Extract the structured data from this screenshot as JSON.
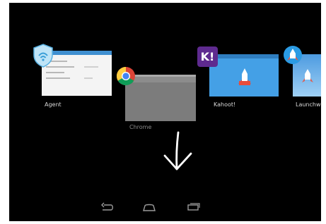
{
  "recents": {
    "cards": [
      {
        "label": "Agent",
        "icon": "shield-wifi-icon",
        "accent": "#3f8fd0"
      },
      {
        "label": "Chrome",
        "icon": "chrome-icon",
        "accent": "#7c7c7c"
      },
      {
        "label": "Kahoot!",
        "icon": "kahoot-icon",
        "icon_text": "K!",
        "accent": "#5e2a8f"
      },
      {
        "label": "Launchw",
        "icon": "rocket-icon",
        "accent": "#4d9be0"
      }
    ]
  },
  "gesture": {
    "icon": "down-arrow-icon"
  },
  "nav": {
    "back": "back-icon",
    "home": "home-icon",
    "recents": "recents-icon"
  }
}
